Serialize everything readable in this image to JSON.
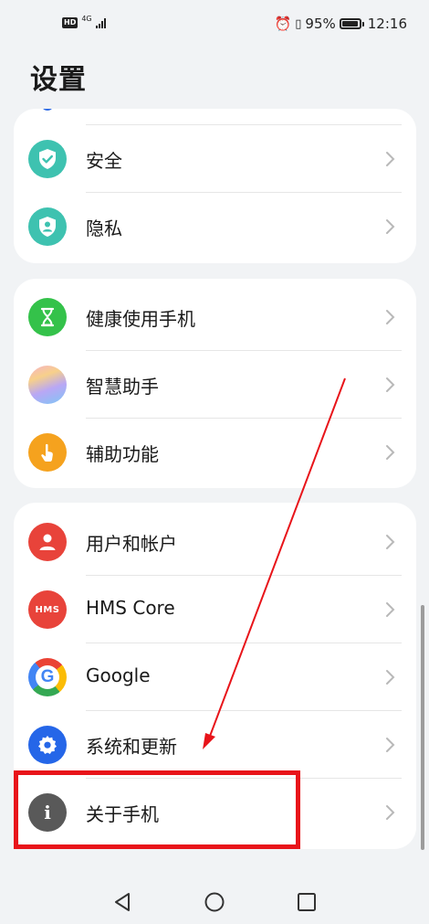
{
  "status_bar": {
    "hd": "HD",
    "network": "4G",
    "battery_text": "95%",
    "battery_level": 0.95,
    "time": "12:16"
  },
  "header": {
    "title": "设置"
  },
  "groups": [
    {
      "items": [
        {
          "label": "安全",
          "icon": "shield-check-icon",
          "color": "#3ec2b0"
        },
        {
          "label": "隐私",
          "icon": "privacy-shield-icon",
          "color": "#3ec2b0"
        }
      ]
    },
    {
      "items": [
        {
          "label": "健康使用手机",
          "icon": "hourglass-icon",
          "color": "#34c24a"
        },
        {
          "label": "智慧助手",
          "icon": "assistant-orb-icon",
          "color": "#c9a4f0"
        },
        {
          "label": "辅助功能",
          "icon": "hand-pointer-icon",
          "color": "#f5a21e"
        }
      ]
    },
    {
      "items": [
        {
          "label": "用户和帐户",
          "icon": "user-icon",
          "color": "#e8433a"
        },
        {
          "label": "HMS Core",
          "icon": "hms-icon",
          "badge": "HMS",
          "color": "#e8433a"
        },
        {
          "label": "Google",
          "icon": "google-icon",
          "badge": "G",
          "color": "#ffffff"
        },
        {
          "label": "系统和更新",
          "icon": "system-gear-icon",
          "color": "#2566e8"
        },
        {
          "label": "关于手机",
          "icon": "info-icon",
          "badge": "i",
          "color": "#595959"
        }
      ]
    }
  ],
  "annotation": {
    "color": "#e8141a"
  }
}
